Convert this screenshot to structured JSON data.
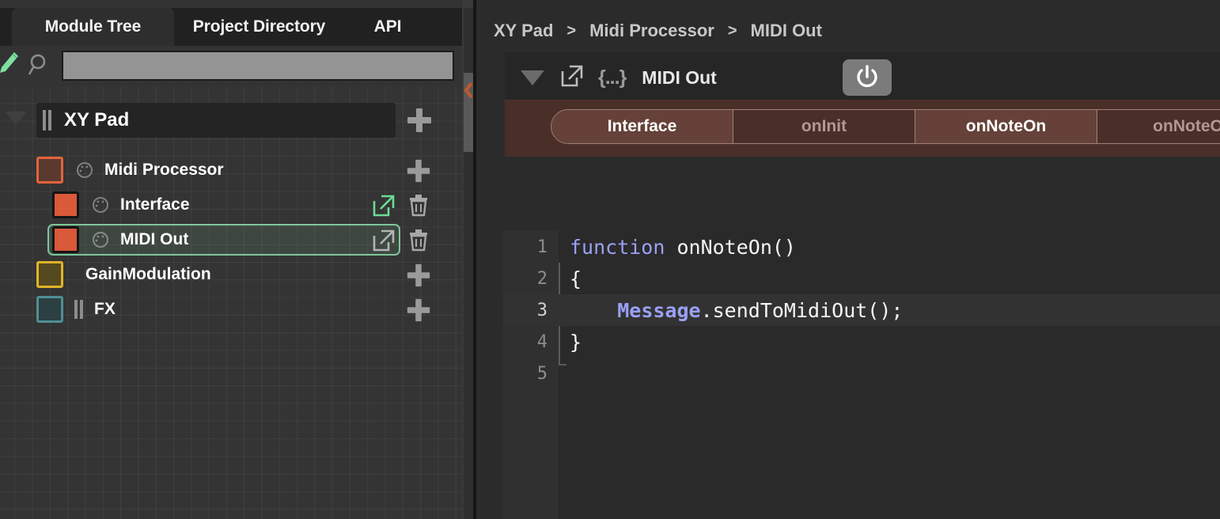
{
  "left_panel": {
    "tabs": [
      {
        "id": "module-tree",
        "label": "Module Tree",
        "active": true
      },
      {
        "id": "project-directory",
        "label": "Project Directory",
        "active": false
      },
      {
        "id": "api",
        "label": "API",
        "active": false
      }
    ],
    "toolbar": {
      "pencil_icon": "pencil-icon",
      "search_icon": "search-icon",
      "search_value": "",
      "search_placeholder": ""
    },
    "root": {
      "label": "XY Pad",
      "expander_icon": "triangle-down-icon",
      "drag_handle_icon": "drag-handle-icon",
      "add_icon": "plus-icon"
    },
    "tree": [
      {
        "label": "Midi Processor",
        "indent": 0,
        "swatch_fill": "#5a3a2e",
        "swatch_border": "#e2643c",
        "has_knob": true,
        "selected": false,
        "actions": [
          "plus-icon"
        ]
      },
      {
        "label": "Interface",
        "indent": 1,
        "swatch_fill": "#d9593a",
        "swatch_border": "#151515",
        "has_knob": true,
        "selected": false,
        "extlink_color": "#6bdc94",
        "actions": [
          "external-link-icon",
          "trash-icon"
        ]
      },
      {
        "label": "MIDI Out",
        "indent": 1,
        "swatch_fill": "#d9593a",
        "swatch_border": "#151515",
        "has_knob": true,
        "selected": true,
        "extlink_color": "#b4b4b4",
        "actions": [
          "external-link-icon",
          "trash-icon"
        ]
      },
      {
        "label": "GainModulation",
        "indent": 0,
        "swatch_fill": "#55491f",
        "swatch_border": "#e0b528",
        "has_knob": false,
        "selected": false,
        "actions": [
          "plus-icon"
        ]
      },
      {
        "label": "FX",
        "indent": 0,
        "swatch_fill": "#2c3f42",
        "swatch_border": "#4f8f96",
        "has_knob": false,
        "has_drag_handle": true,
        "selected": false,
        "actions": [
          "plus-icon"
        ]
      }
    ],
    "scrollbar": {
      "collapse_icon": "chevron-left-icon",
      "collapse_icon_color": "#c2582e"
    }
  },
  "right_panel": {
    "breadcrumb": {
      "items": [
        "XY Pad",
        "Midi Processor",
        "MIDI Out"
      ],
      "separator": ">"
    },
    "module_header": {
      "expander_icon": "triangle-down-icon",
      "popout_icon": "external-link-icon",
      "code_icon": "braces-icon",
      "code_icon_glyph": "{...}",
      "title": "MIDI Out",
      "power_icon": "power-icon",
      "power_on": true
    },
    "tabs": [
      {
        "label": "Interface",
        "active": true
      },
      {
        "label": "onInit",
        "active": false
      },
      {
        "label": "onNoteOn",
        "active": true
      },
      {
        "label": "onNoteO",
        "active": false
      }
    ],
    "tab_accent": "#4a2e28",
    "editor": {
      "lines": [
        {
          "number": "1",
          "current": false,
          "tokens": [
            {
              "text": "function ",
              "type": "kw"
            },
            {
              "text": "onNoteOn()",
              "type": "pln"
            }
          ]
        },
        {
          "number": "2",
          "current": false,
          "tokens": [
            {
              "text": "{",
              "type": "pln"
            }
          ]
        },
        {
          "number": "3",
          "current": true,
          "tokens": [
            {
              "text": "    ",
              "type": "pln"
            },
            {
              "text": "Message",
              "type": "obj"
            },
            {
              "text": ".sendToMidiOut();",
              "type": "pln"
            }
          ]
        },
        {
          "number": "4",
          "current": false,
          "tokens": [
            {
              "text": "}",
              "type": "pln"
            }
          ]
        },
        {
          "number": "5",
          "current": false,
          "tokens": [
            {
              "text": "",
              "type": "pln"
            }
          ]
        }
      ]
    }
  }
}
